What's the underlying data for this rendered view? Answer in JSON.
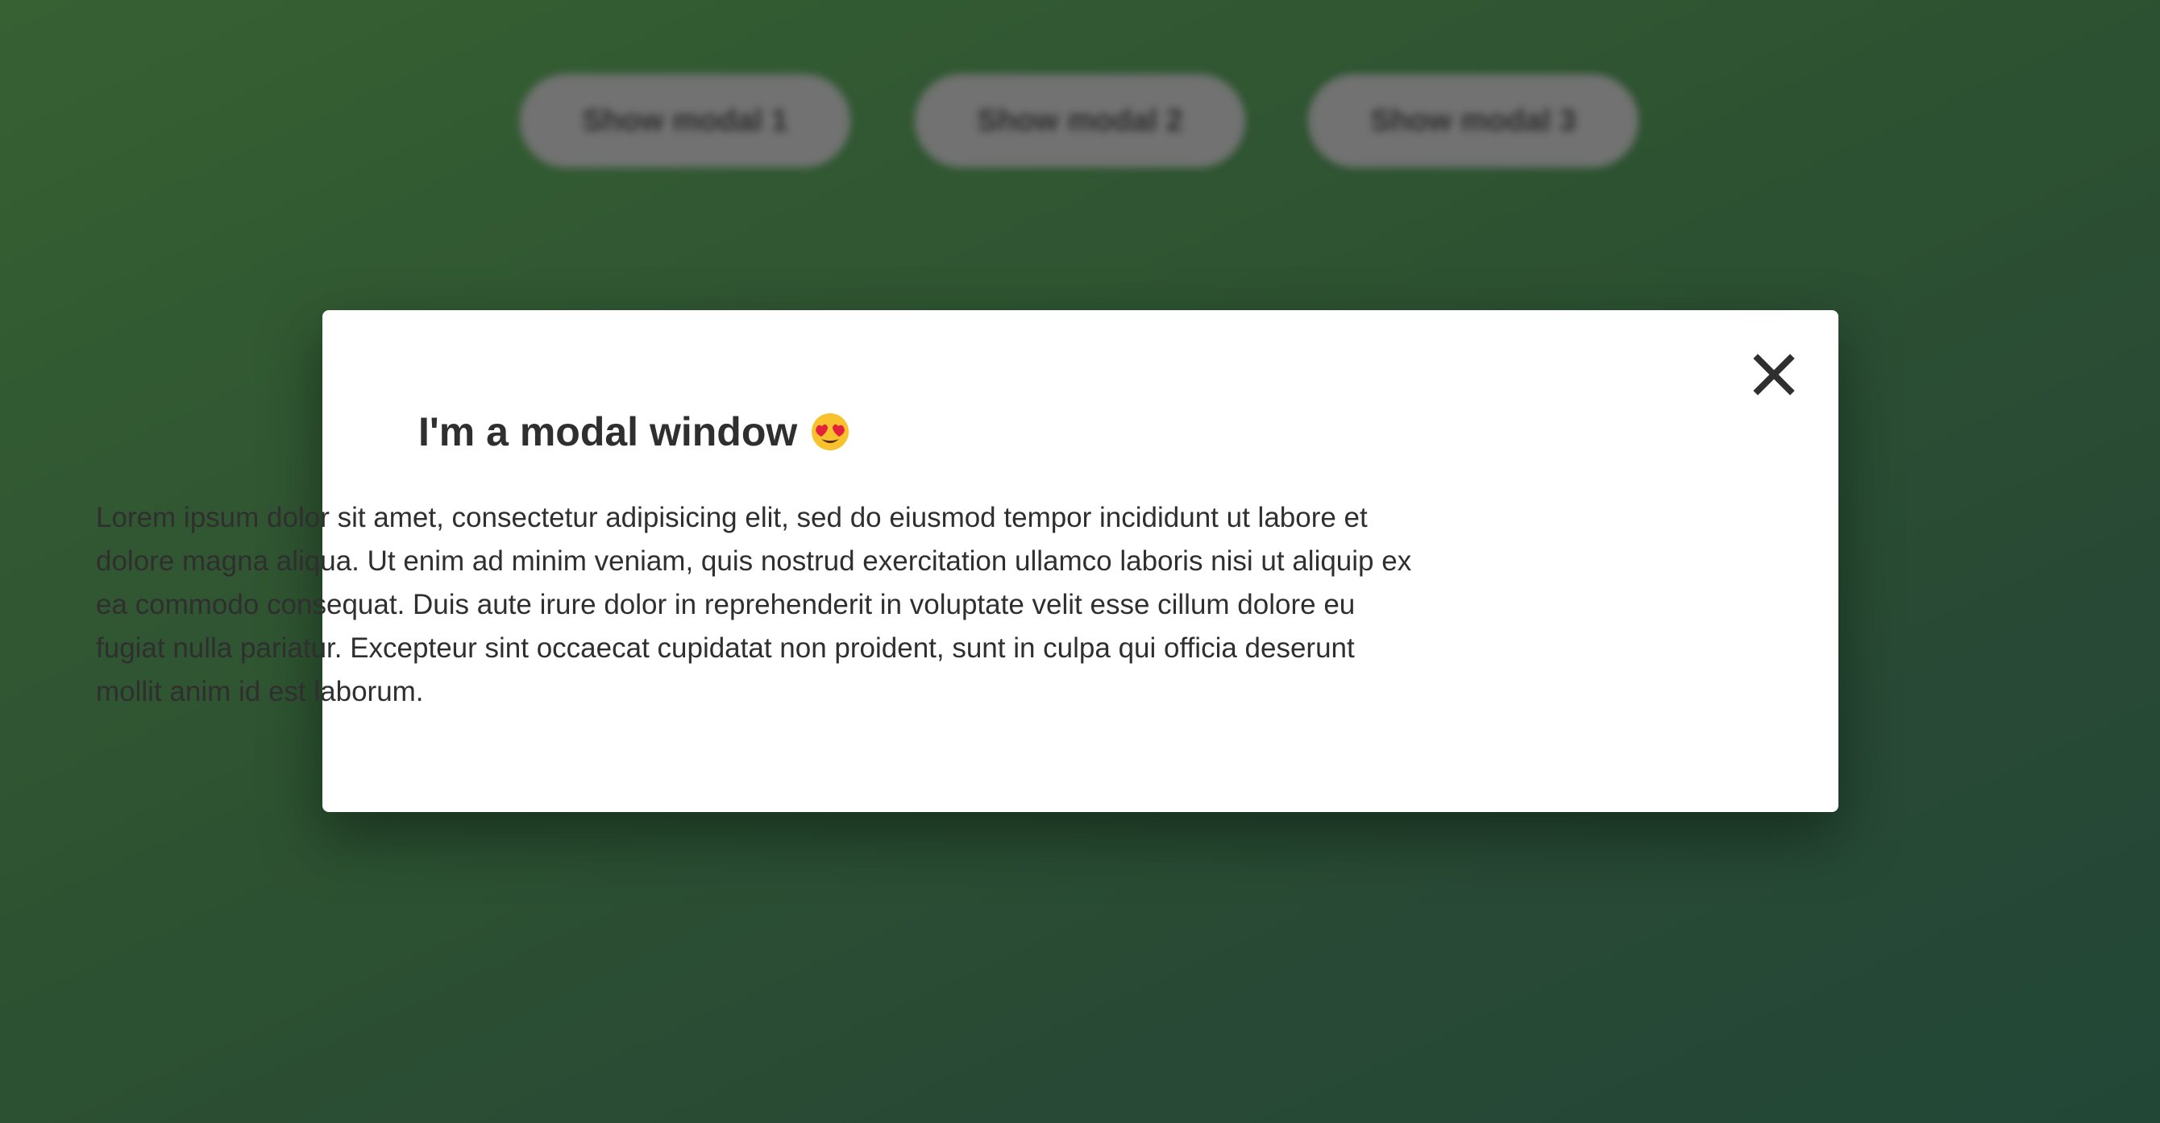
{
  "buttons": [
    {
      "label": "Show modal 1"
    },
    {
      "label": "Show modal 2"
    },
    {
      "label": "Show modal 3"
    }
  ],
  "modal": {
    "title": "I'm a modal window",
    "title_icon": "heart-eyes-emoji-icon",
    "close_icon": "close-icon",
    "body": "Lorem ipsum dolor sit amet, consectetur adipisicing elit, sed do eiusmod tempor incididunt ut labore et dolore magna aliqua. Ut enim ad minim veniam, quis nostrud exercitation ullamco laboris nisi ut aliquip ex ea commodo consequat. Duis aute irure dolor in reprehenderit in voluptate velit esse cillum dolore eu fugiat nulla pariatur. Excepteur sint occaecat cupidatat non proident, sunt in culpa qui officia deserunt mollit anim id est laborum."
  },
  "colors": {
    "background_start": "#3a6636",
    "background_end": "#234a3a",
    "modal_background": "#ffffff",
    "text": "#2f2f2f",
    "button_background": "#797979"
  }
}
